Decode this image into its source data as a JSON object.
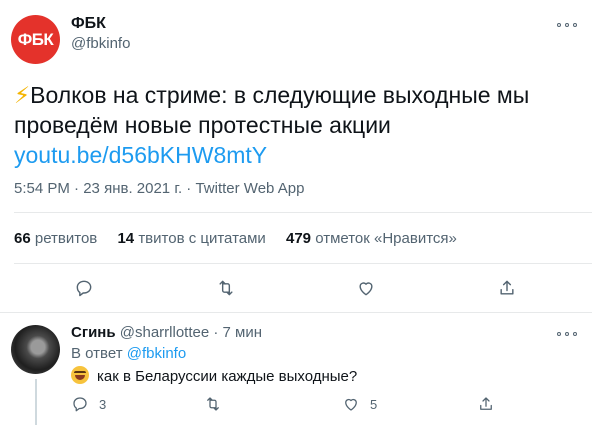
{
  "tweet": {
    "avatar_text": "ФБК",
    "author_name": "ФБК",
    "author_handle": "@fbkinfo",
    "text_emoji": "⚡",
    "text": "Волков на стриме: в следующие выходные мы проведём новые протестные акции",
    "link": "youtu.be/d56bKHW8mtY",
    "time": "5:54 PM",
    "date": "23 янв. 2021 г.",
    "source": "Twitter Web App",
    "separator": "·",
    "stats": {
      "retweets_count": "66",
      "retweets_label": "ретвитов",
      "quotes_count": "14",
      "quotes_label": "твитов с цитатами",
      "likes_count": "479",
      "likes_label": "отметок «Нравится»"
    }
  },
  "reply": {
    "author_name": "Сгинь",
    "author_handle": "@sharrllottee",
    "separator": "·",
    "time": "7 мин",
    "reply_prefix": "В ответ",
    "reply_mention": "@fbkinfo",
    "text": "как в Беларуссии каждые выходные?",
    "reply_count": "3",
    "like_count": "5"
  },
  "icons": {
    "reply": "reply-icon",
    "retweet": "retweet-icon",
    "like": "heart-icon",
    "share": "share-icon",
    "more": "more-icon"
  },
  "colors": {
    "brand_red": "#e4322b",
    "link_blue": "#1d9bf0",
    "secondary_text": "#536471"
  }
}
